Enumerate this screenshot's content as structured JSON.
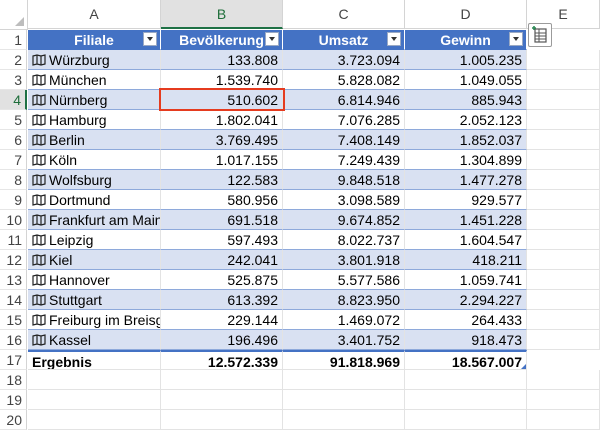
{
  "columns": [
    "A",
    "B",
    "C",
    "D",
    "E"
  ],
  "active_column": "B",
  "active_row": "4",
  "rows": [
    "1",
    "2",
    "3",
    "4",
    "5",
    "6",
    "7",
    "8",
    "9",
    "10",
    "11",
    "12",
    "13",
    "14",
    "15",
    "16",
    "17",
    "18",
    "19",
    "20"
  ],
  "table": {
    "headers": [
      "Filiale",
      "Bevölkerung",
      "Umsatz",
      "Gewinn"
    ],
    "records": [
      {
        "filiale": "Würzburg",
        "bevoelkerung": "133.808",
        "umsatz": "3.723.094",
        "gewinn": "1.005.235"
      },
      {
        "filiale": "München",
        "bevoelkerung": "1.539.740",
        "umsatz": "5.828.082",
        "gewinn": "1.049.055"
      },
      {
        "filiale": "Nürnberg",
        "bevoelkerung": "510.602",
        "umsatz": "6.814.946",
        "gewinn": "885.943"
      },
      {
        "filiale": "Hamburg",
        "bevoelkerung": "1.802.041",
        "umsatz": "7.076.285",
        "gewinn": "2.052.123"
      },
      {
        "filiale": "Berlin",
        "bevoelkerung": "3.769.495",
        "umsatz": "7.408.149",
        "gewinn": "1.852.037"
      },
      {
        "filiale": "Köln",
        "bevoelkerung": "1.017.155",
        "umsatz": "7.249.439",
        "gewinn": "1.304.899"
      },
      {
        "filiale": "Wolfsburg",
        "bevoelkerung": "122.583",
        "umsatz": "9.848.518",
        "gewinn": "1.477.278"
      },
      {
        "filiale": "Dortmund",
        "bevoelkerung": "580.956",
        "umsatz": "3.098.589",
        "gewinn": "929.577"
      },
      {
        "filiale": "Frankfurt am Main",
        "bevoelkerung": "691.518",
        "umsatz": "9.674.852",
        "gewinn": "1.451.228"
      },
      {
        "filiale": "Leipzig",
        "bevoelkerung": "597.493",
        "umsatz": "8.022.737",
        "gewinn": "1.604.547"
      },
      {
        "filiale": "Kiel",
        "bevoelkerung": "242.041",
        "umsatz": "3.801.918",
        "gewinn": "418.211"
      },
      {
        "filiale": "Hannover",
        "bevoelkerung": "525.875",
        "umsatz": "5.577.586",
        "gewinn": "1.059.741"
      },
      {
        "filiale": "Stuttgart",
        "bevoelkerung": "613.392",
        "umsatz": "8.823.950",
        "gewinn": "2.294.227"
      },
      {
        "filiale": "Freiburg im Breisgau",
        "bevoelkerung": "229.144",
        "umsatz": "1.469.072",
        "gewinn": "264.433"
      },
      {
        "filiale": "Kassel",
        "bevoelkerung": "196.496",
        "umsatz": "3.401.752",
        "gewinn": "918.473"
      }
    ],
    "total": {
      "label": "Ergebnis",
      "bevoelkerung": "12.572.339",
      "umsatz": "91.818.969",
      "gewinn": "18.567.007"
    }
  },
  "selected_cell": "B4",
  "colors": {
    "header": "#4472c4",
    "band": "#d9e1f2",
    "selection": "#e53b1f",
    "active_header": "#1e7145"
  },
  "icons": {
    "record": "map-icon",
    "quick_analysis": "quick-analysis-icon",
    "filter": "filter-dropdown-icon"
  }
}
